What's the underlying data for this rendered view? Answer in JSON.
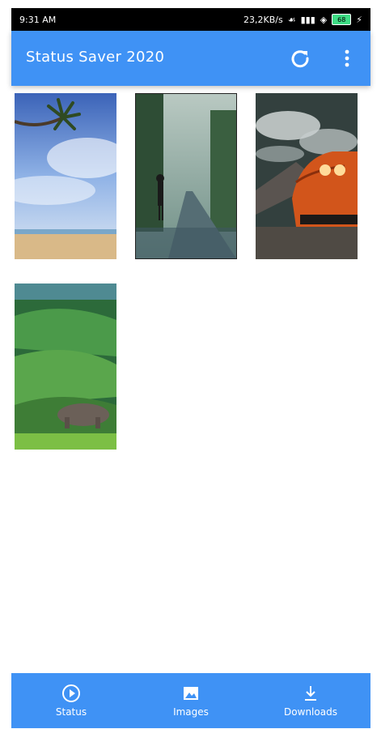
{
  "status_bar": {
    "time": "9:31 AM",
    "speed": "23,2KB/s",
    "battery": "68"
  },
  "app_bar": {
    "title": "Status Saver 2020",
    "icons": [
      "refresh-icon",
      "more-vert-icon"
    ]
  },
  "grid": {
    "items": [
      {
        "subject": "beach-palm"
      },
      {
        "subject": "forest-road-person"
      },
      {
        "subject": "orange-car"
      },
      {
        "subject": "green-hills-elephant"
      }
    ]
  },
  "bottom_nav": {
    "items": [
      {
        "label": "Status",
        "icon": "play-circle-icon"
      },
      {
        "label": "Images",
        "icon": "image-icon"
      },
      {
        "label": "Downloads",
        "icon": "download-icon"
      }
    ]
  },
  "colors": {
    "primary": "#3f92f5",
    "status_bar": "#000000",
    "background": "#ffffff"
  }
}
